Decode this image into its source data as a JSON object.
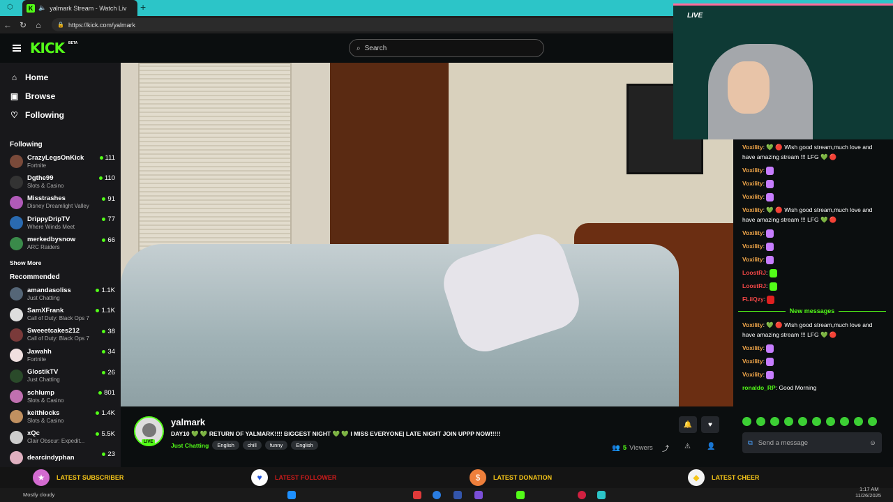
{
  "browser": {
    "tab_title": "yalmark Stream - Watch Liv",
    "url": "https://kick.com/yalmark",
    "new_tab": "+"
  },
  "header": {
    "logo": "KICK",
    "beta": "BETA",
    "search_placeholder": "Search"
  },
  "sidebar": {
    "nav": [
      {
        "label": "Home",
        "icon": "home-icon"
      },
      {
        "label": "Browse",
        "icon": "browse-icon"
      },
      {
        "label": "Following",
        "icon": "heart-icon"
      }
    ],
    "following_title": "Following",
    "following": [
      {
        "name": "CrazyLegsOnKick",
        "category": "Fortnite",
        "viewers": "111",
        "color": "#7a4a3a"
      },
      {
        "name": "Dgthe99",
        "category": "Slots & Casino",
        "viewers": "110",
        "color": "#333333"
      },
      {
        "name": "Misstrashes",
        "category": "Disney Dreamlight Valley",
        "viewers": "91",
        "color": "#b05ab8"
      },
      {
        "name": "DrippyDripTV",
        "category": "Where Winds Meet",
        "viewers": "77",
        "color": "#2a6ab0"
      },
      {
        "name": "merkedbysnow",
        "category": "ARC Raiders",
        "viewers": "66",
        "color": "#3a8a4a"
      }
    ],
    "show_more": "Show More",
    "recommended_title": "Recommended",
    "recommended": [
      {
        "name": "amandasoliss",
        "category": "Just Chatting",
        "viewers": "1.1K",
        "color": "#556677"
      },
      {
        "name": "SamXFrank",
        "category": "Call of Duty: Black Ops 7",
        "viewers": "1.1K",
        "color": "#dddddd"
      },
      {
        "name": "Sweeetcakes212",
        "category": "Call of Duty: Black Ops 7",
        "viewers": "38",
        "color": "#7a3a3a"
      },
      {
        "name": "Jawahh",
        "category": "Fortnite",
        "viewers": "34",
        "color": "#f0e0e0"
      },
      {
        "name": "GlostikTV",
        "category": "Just Chatting",
        "viewers": "26",
        "color": "#2a4a2a"
      },
      {
        "name": "schlump",
        "category": "Slots & Casino",
        "viewers": "801",
        "color": "#c070b0"
      },
      {
        "name": "keithlocks",
        "category": "Slots & Casino",
        "viewers": "1.4K",
        "color": "#c09060"
      },
      {
        "name": "xQc",
        "category": "Clair Obscur: Expedit...",
        "viewers": "5.5K",
        "color": "#cccccc"
      },
      {
        "name": "dearcindyphan",
        "category": "",
        "viewers": "23",
        "color": "#e0b0c0"
      }
    ]
  },
  "stream": {
    "streamer": "yalmark",
    "live": "LIVE",
    "title": "DAY10 💚 💚 RETURN OF YALMARK!!!! BIGGEST NIGHT 💚 💚 I MISS EVERYONE| LATE NIGHT JOIN UPPP NOW!!!!!",
    "category": "Just Chatting",
    "tags": [
      "English",
      "chill",
      "funny",
      "English"
    ],
    "viewers_count": "5",
    "viewers_label": "Viewers"
  },
  "cam": {
    "live_label": "LIVE"
  },
  "chat": {
    "messages_top": [
      {
        "user": "Voxility",
        "text": "💚 🔴 Wish good stream,much love and have amazing stream !!! LFG 💚 🔴"
      },
      {
        "user": "Voxility",
        "text": "",
        "emote": "#c77dff"
      },
      {
        "user": "Voxility",
        "text": "",
        "emote": "#c77dff"
      },
      {
        "user": "Voxility",
        "text": "",
        "emote": "#c77dff"
      },
      {
        "user": "Voxility",
        "text": "💚 🔴 Wish good stream,much love and have amazing stream !!! LFG 💚 🔴"
      },
      {
        "user": "Voxility",
        "text": "",
        "emote": "#c77dff"
      },
      {
        "user": "Voxility",
        "text": "",
        "emote": "#c77dff"
      },
      {
        "user": "Voxility",
        "text": "",
        "emote": "#c77dff"
      },
      {
        "user": "LoostRJ",
        "text": "",
        "emote": "#53fc18",
        "style": "r"
      },
      {
        "user": "LoostRJ",
        "text": "",
        "emote": "#53fc18",
        "style": "r"
      },
      {
        "user": "FLiiQzy",
        "text": "",
        "emote": "#e02020",
        "style": "r"
      }
    ],
    "new_messages": "New messages",
    "messages_bottom": [
      {
        "user": "Voxility",
        "text": "💚 🔴 Wish good stream,much love and have amazing stream !!! LFG 💚 🔴"
      },
      {
        "user": "Voxility",
        "text": "",
        "emote": "#c77dff"
      },
      {
        "user": "Voxility",
        "text": "",
        "emote": "#c77dff"
      },
      {
        "user": "Voxility",
        "text": "",
        "emote": "#c77dff"
      },
      {
        "user": "ronaldo_RP",
        "text": "Good Morning",
        "style": "g"
      }
    ],
    "send_placeholder": "Send a message"
  },
  "alerts": [
    {
      "label": "LATEST SUBSCRIBER",
      "icon": "star-icon",
      "color": "#f5c518",
      "bg": "#d36bd0"
    },
    {
      "label": "LATEST FOLLOWER",
      "icon": "heart-icon",
      "color": "#cc1b1b",
      "bg": "#ffffff"
    },
    {
      "label": "LATEST DONATION",
      "icon": "dollar-icon",
      "color": "#f5c518",
      "bg": "#ee7f3b"
    },
    {
      "label": "LATEST CHEER",
      "icon": "diamond-icon",
      "color": "#f5c518",
      "bg": "#f3f3f3"
    }
  ],
  "taskbar": {
    "weather": "Mostly cloudy",
    "time": "1:17 AM",
    "date": "11/26/2025"
  }
}
